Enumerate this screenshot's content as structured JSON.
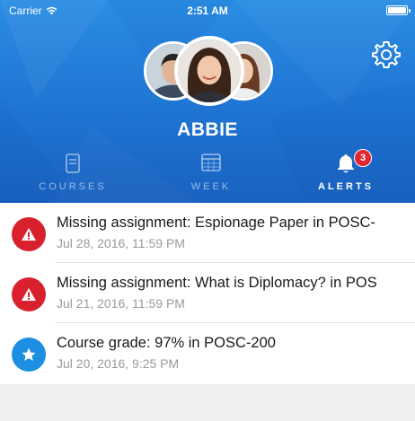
{
  "status_bar": {
    "carrier": "Carrier",
    "time": "2:51 AM"
  },
  "profile": {
    "name": "ABBIE"
  },
  "tabs": [
    {
      "label": "COURSES",
      "icon": "book-icon",
      "active": false
    },
    {
      "label": "WEEK",
      "icon": "calendar-icon",
      "active": false
    },
    {
      "label": "ALERTS",
      "icon": "bell-icon",
      "active": true,
      "badge": "3"
    }
  ],
  "alerts": [
    {
      "type": "warning",
      "icon": "warning-icon",
      "title": "Missing assignment: Espionage Paper in POSC-",
      "date": "Jul 28, 2016, 11:59 PM"
    },
    {
      "type": "warning",
      "icon": "warning-icon",
      "title": "Missing assignment: What is Diplomacy? in POS",
      "date": "Jul 21, 2016, 11:59 PM"
    },
    {
      "type": "grade",
      "icon": "star-icon",
      "title": "Course grade: 97% in POSC-200",
      "date": "Jul 20, 2016, 9:25 PM"
    }
  ],
  "colors": {
    "header_blue": "#1f74d2",
    "alert_red": "#d9212e",
    "grade_blue": "#1c8fe0",
    "badge_red": "#e0262f"
  }
}
